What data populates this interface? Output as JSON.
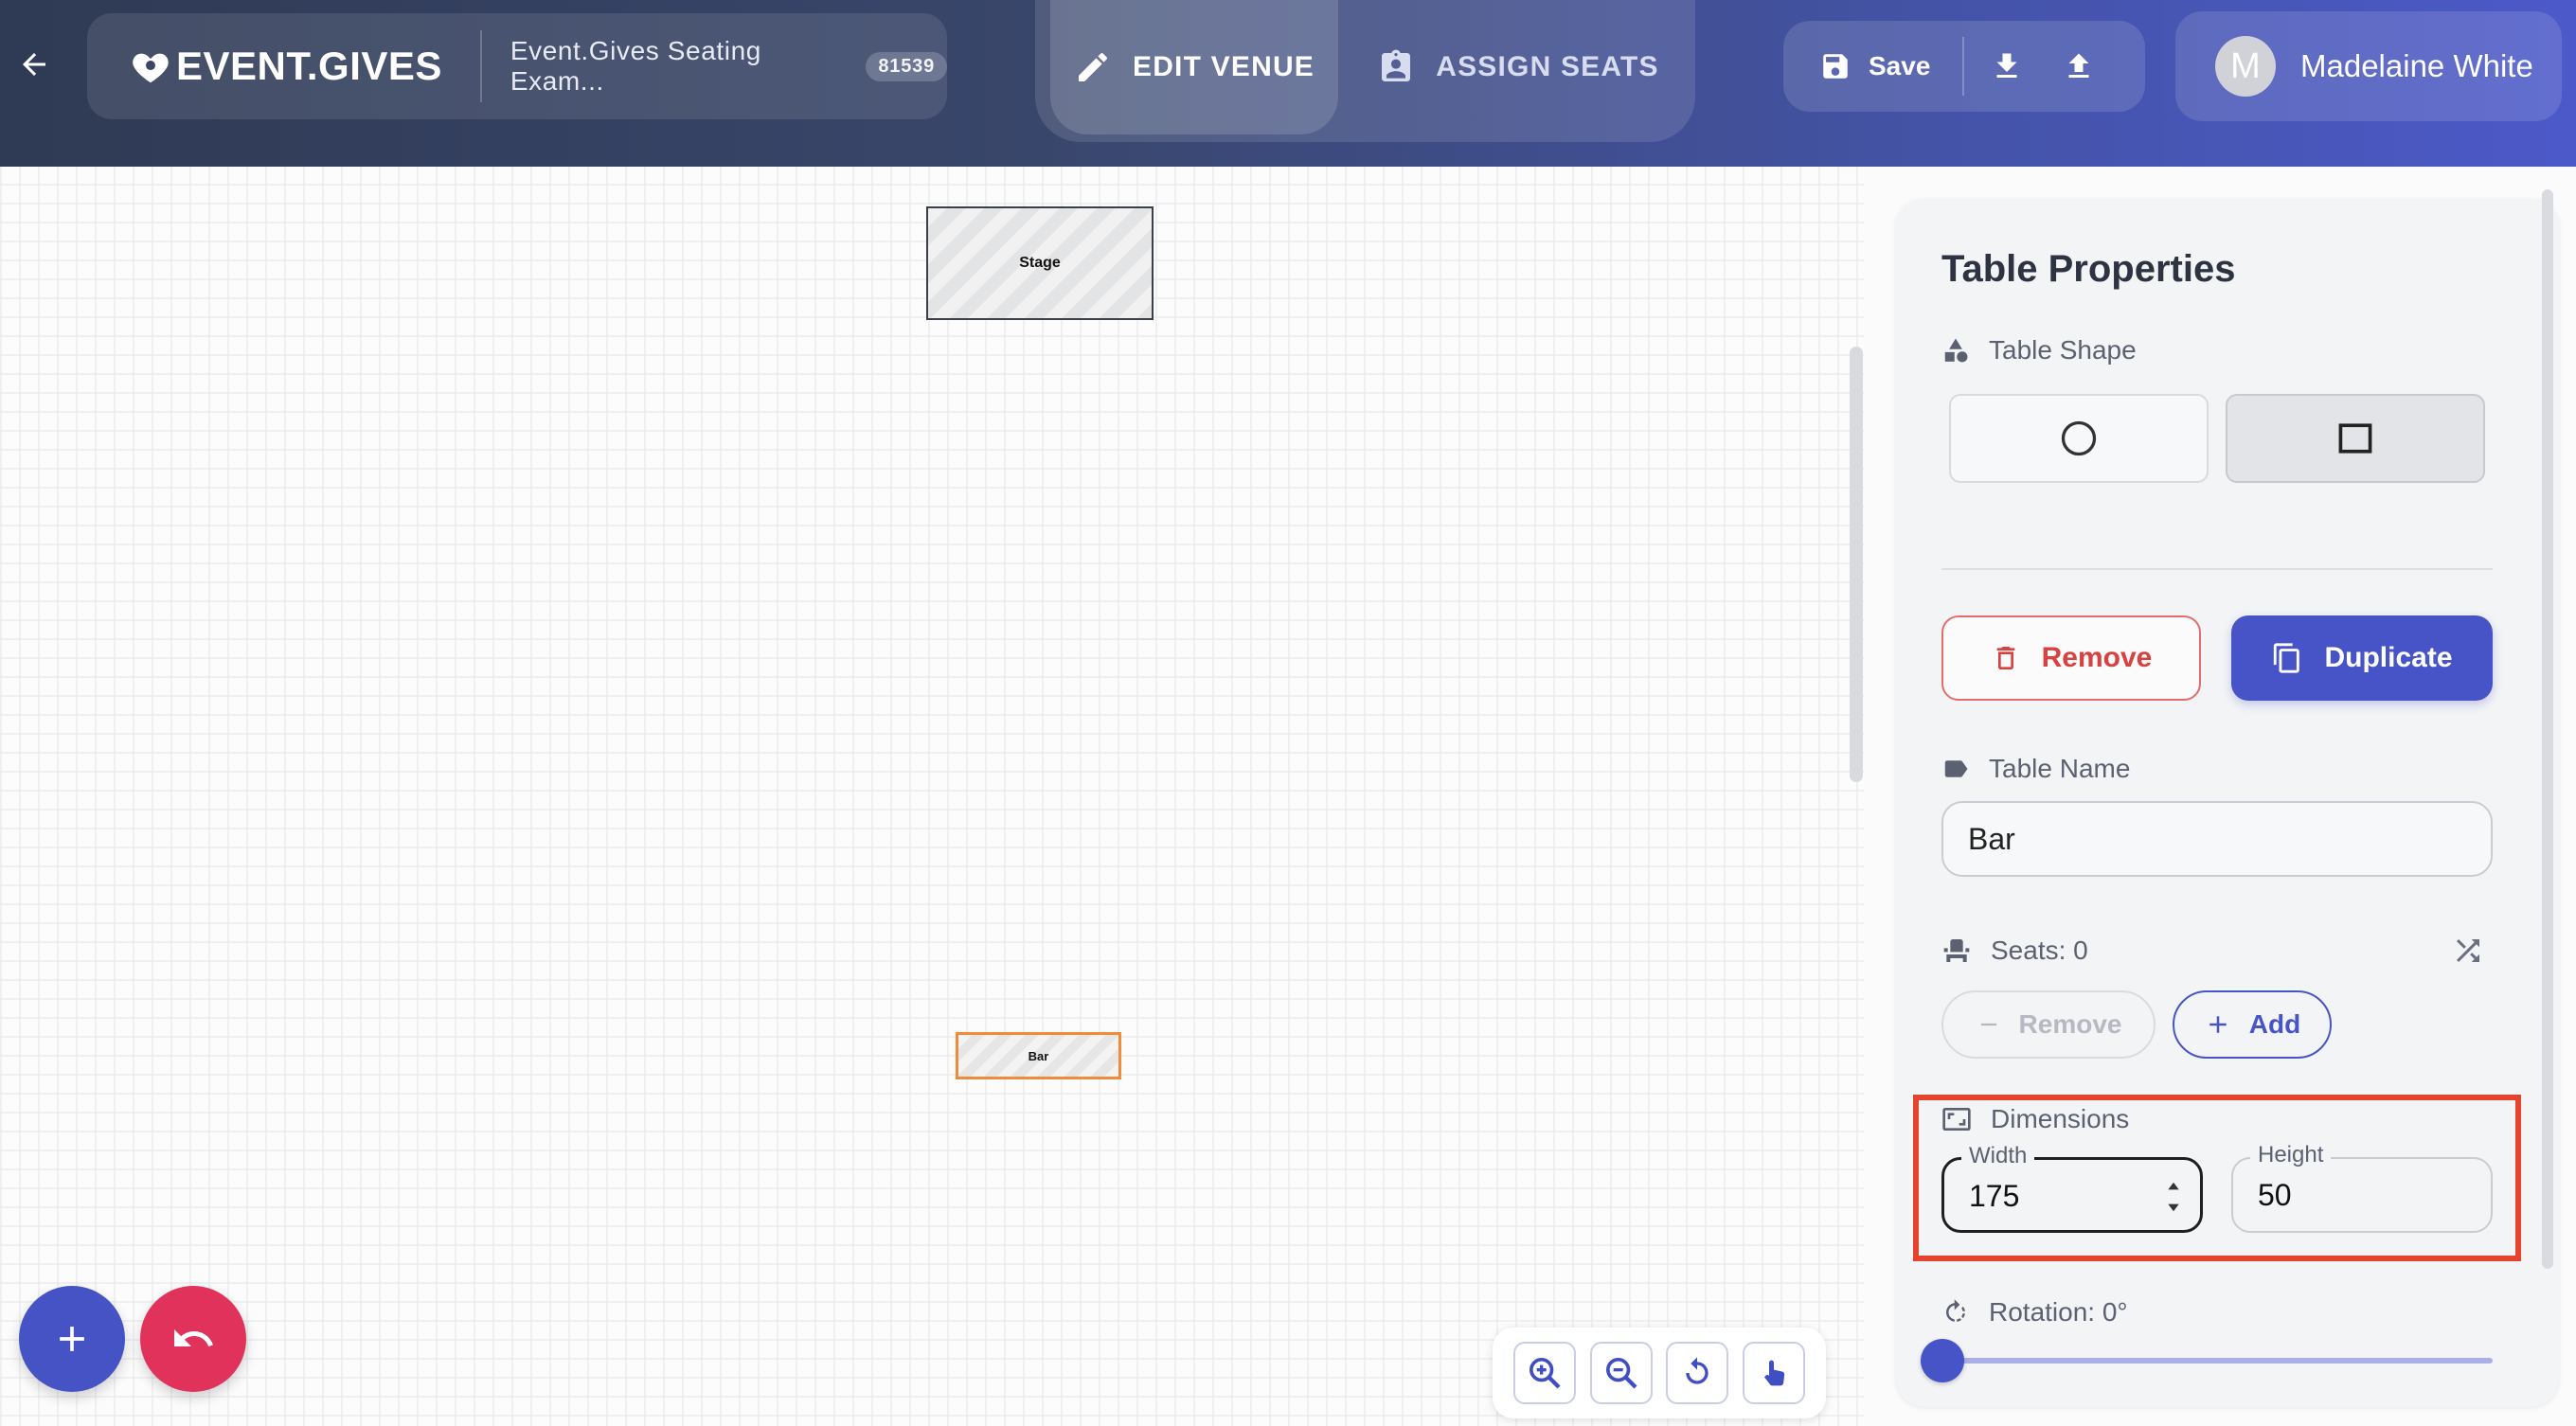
{
  "header": {
    "brand": "EVENT.GIVES",
    "event_name": "Event.Gives Seating Exam...",
    "event_id": "81539",
    "modes": {
      "edit": "EDIT VENUE",
      "assign": "ASSIGN SEATS"
    },
    "save_label": "Save",
    "user": {
      "initial": "M",
      "name": "Madelaine White"
    }
  },
  "canvas": {
    "stage_label": "Stage",
    "bar_label": "Bar"
  },
  "panel": {
    "title": "Table Properties",
    "shape_label": "Table Shape",
    "remove_label": "Remove",
    "duplicate_label": "Duplicate",
    "name_label": "Table Name",
    "name_value": "Bar",
    "seats_label": "Seats: 0",
    "seat_remove_label": "Remove",
    "seat_add_label": "Add",
    "dimensions_label": "Dimensions",
    "width_label": "Width",
    "width_value": "175",
    "height_label": "Height",
    "height_value": "50",
    "rotation_label": "Rotation: 0°"
  },
  "colors": {
    "primary": "#4654c8",
    "danger": "#e0325b",
    "highlight": "#e5432e",
    "selected_outline": "#f08b3c"
  }
}
